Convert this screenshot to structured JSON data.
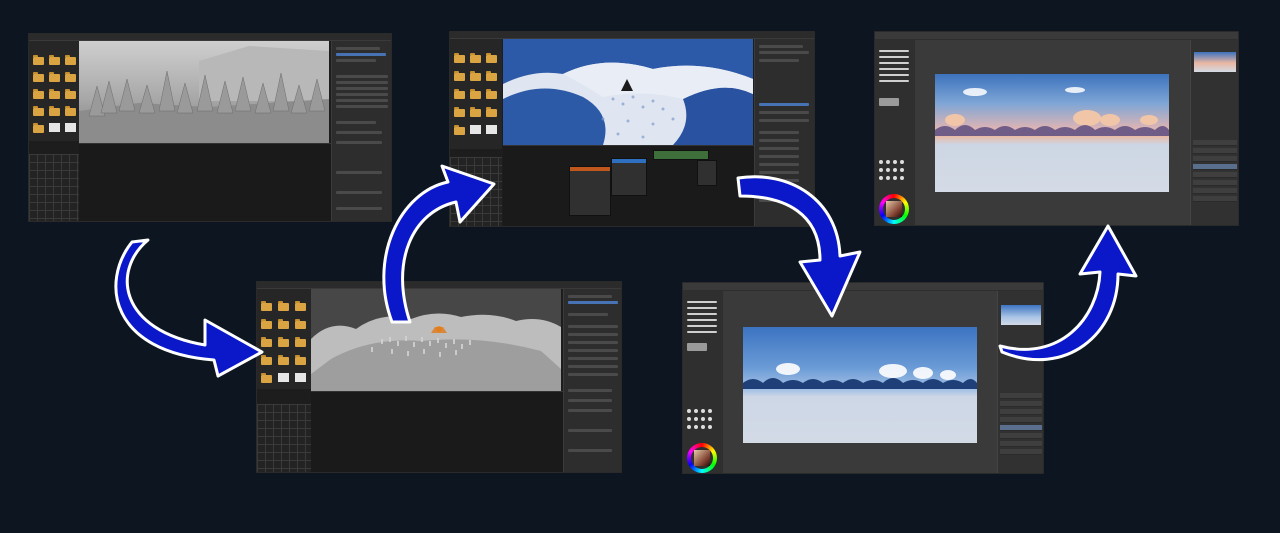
{
  "diagram": {
    "background": "#0c1520",
    "arrow_fill": "#0b18c9",
    "arrow_stroke": "#ffffff",
    "steps": [
      {
        "id": "step-1",
        "app": "blender",
        "view": "forest-model"
      },
      {
        "id": "step-2",
        "app": "blender",
        "view": "terrain-model"
      },
      {
        "id": "step-3",
        "app": "blender",
        "view": "stylized-render"
      },
      {
        "id": "step-4",
        "app": "krita",
        "view": "sky-panorama-paint"
      },
      {
        "id": "step-5",
        "app": "krita",
        "view": "sunset-panorama-paint"
      }
    ],
    "flow": [
      "step-1",
      "step-2",
      "step-3",
      "step-4",
      "step-5"
    ]
  }
}
